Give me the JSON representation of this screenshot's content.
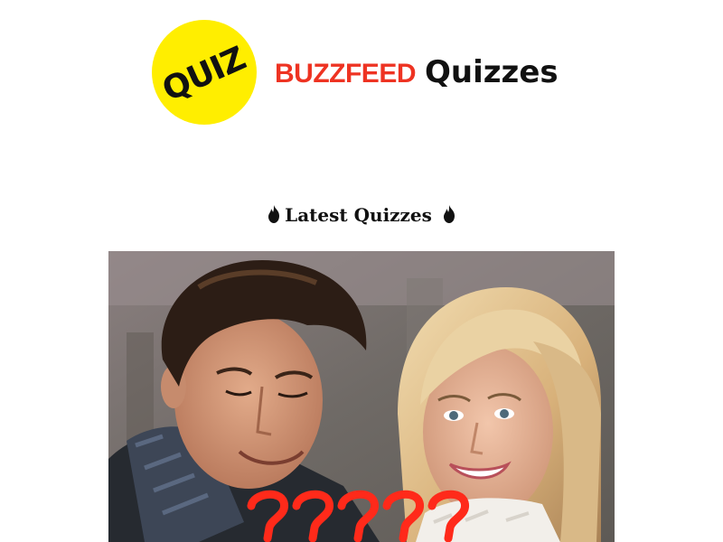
{
  "header": {
    "badge_text": "QUIZ",
    "brand_name": "BuzzFeed",
    "brand_suffix": "Quizzes",
    "badge_color": "#FFEE00",
    "brand_color": "#EE3322"
  },
  "section": {
    "heading": "Latest Quizzes",
    "icon": "fire-icon"
  },
  "quiz_card": {
    "image_description_icon": "photo-couple",
    "overlay_icon": "question-marks-icon"
  }
}
